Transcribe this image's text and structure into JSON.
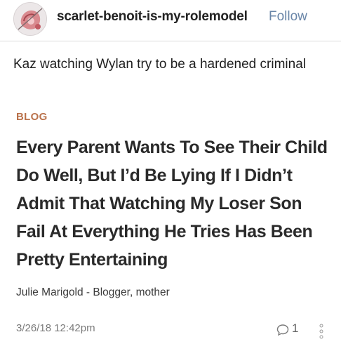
{
  "post": {
    "username": "scarlet-benoit-is-my-rolemodel",
    "follow_label": "Follow",
    "caption": "Kaz watching Wylan try to be a hardened criminal"
  },
  "article": {
    "tag": "BLOG",
    "headline": "Every Parent Wants To See Their Child Do Well, But I’d Be Lying If I Didn’t Admit That Watching My Loser Son Fail At Everything He Tries Has Been Pretty Entertaining",
    "byline": "Julie Marigold - Blogger, mother",
    "date": "3/26/18 12:42pm",
    "comment_count": "1"
  },
  "icons": {
    "avatar": "avatar-image",
    "comment": "speech-bubble-icon",
    "more": "vertical-dots-icon"
  },
  "colors": {
    "follow": "#6a86a8",
    "tag": "#b9714a",
    "date": "#7a7a7a"
  }
}
